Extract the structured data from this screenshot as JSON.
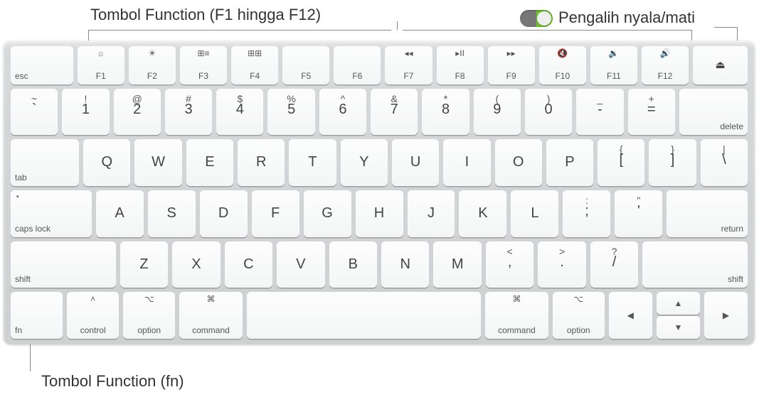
{
  "labels": {
    "function_keys": "Tombol Function (F1 hingga F12)",
    "toggle": "Pengalih nyala/mati",
    "fn_key": "Tombol Function (fn)"
  },
  "row_fn": {
    "esc": "esc",
    "keys": [
      {
        "icon": "☼",
        "label": "F1"
      },
      {
        "icon": "☀",
        "label": "F2"
      },
      {
        "icon": "⊞≡",
        "label": "F3"
      },
      {
        "icon": "⊞⊞",
        "label": "F4"
      },
      {
        "icon": "",
        "label": "F5"
      },
      {
        "icon": "",
        "label": "F6"
      },
      {
        "icon": "◂◂",
        "label": "F7"
      },
      {
        "icon": "▸II",
        "label": "F8"
      },
      {
        "icon": "▸▸",
        "label": "F9"
      },
      {
        "icon": "🔇",
        "label": "F10"
      },
      {
        "icon": "🔉",
        "label": "F11"
      },
      {
        "icon": "🔊",
        "label": "F12"
      }
    ],
    "eject": "⏏"
  },
  "row_num": {
    "keys": [
      {
        "upper": "~",
        "lower": "`"
      },
      {
        "upper": "!",
        "lower": "1"
      },
      {
        "upper": "@",
        "lower": "2"
      },
      {
        "upper": "#",
        "lower": "3"
      },
      {
        "upper": "$",
        "lower": "4"
      },
      {
        "upper": "%",
        "lower": "5"
      },
      {
        "upper": "^",
        "lower": "6"
      },
      {
        "upper": "&",
        "lower": "7"
      },
      {
        "upper": "*",
        "lower": "8"
      },
      {
        "upper": "(",
        "lower": "9"
      },
      {
        "upper": ")",
        "lower": "0"
      },
      {
        "upper": "_",
        "lower": "-"
      },
      {
        "upper": "+",
        "lower": "="
      }
    ],
    "delete": "delete"
  },
  "row_q": {
    "tab": "tab",
    "keys": [
      "Q",
      "W",
      "E",
      "R",
      "T",
      "Y",
      "U",
      "I",
      "O",
      "P"
    ],
    "bracket_l": {
      "upper": "{",
      "lower": "["
    },
    "bracket_r": {
      "upper": "}",
      "lower": "]"
    },
    "backslash": {
      "upper": "|",
      "lower": "\\"
    }
  },
  "row_a": {
    "caps": "caps lock",
    "keys": [
      "A",
      "S",
      "D",
      "F",
      "G",
      "H",
      "J",
      "K",
      "L"
    ],
    "semicolon": {
      "upper": ":",
      "lower": ";"
    },
    "quote": {
      "upper": "\"",
      "lower": "'"
    },
    "return": "return"
  },
  "row_z": {
    "shift_l": "shift",
    "keys": [
      "Z",
      "X",
      "C",
      "V",
      "B",
      "N",
      "M"
    ],
    "comma": {
      "upper": "<",
      "lower": ","
    },
    "period": {
      "upper": ">",
      "lower": "."
    },
    "slash": {
      "upper": "?",
      "lower": "/"
    },
    "shift_r": "shift"
  },
  "row_bot": {
    "fn": "fn",
    "control": {
      "sym": "˄",
      "label": "control"
    },
    "option_l": {
      "sym": "⌥",
      "label": "option"
    },
    "command_l": {
      "sym": "⌘",
      "label": "command"
    },
    "command_r": {
      "sym": "⌘",
      "label": "command"
    },
    "option_r": {
      "sym": "⌥",
      "label": "option"
    },
    "left": "◀",
    "up": "▲",
    "down": "▼",
    "right": "▶"
  }
}
